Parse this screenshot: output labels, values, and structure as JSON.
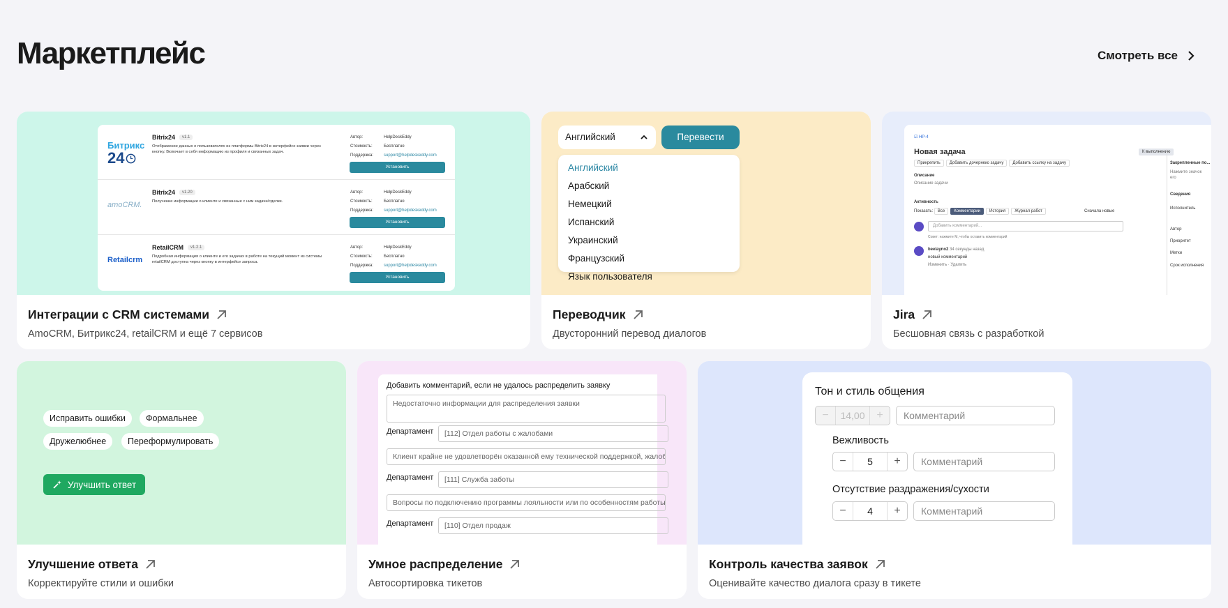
{
  "header": {
    "title": "Маркетплейс",
    "see_all": "Смотреть все"
  },
  "cards": {
    "crm": {
      "title": "Интеграции с CRM системами",
      "subtitle": "AmoCRM, Битрикс24, retailCRM и ещё 7 сервисов",
      "preview": {
        "meta_labels": {
          "author": "Автор:",
          "cost": "Стоимость:",
          "support": "Поддержка:"
        },
        "install": "Установить",
        "rows": [
          {
            "name": "Bitrix24",
            "version": "v1.1",
            "logo_top": "Битрикс",
            "logo_bottom": "24",
            "desc": "Отображение данных о пользователях из платформы Bitrix24 в интерфейсе заявки через кнопку. Включает в себя информацию из профиля и связанных задач.",
            "author": "HelpDeskEddy",
            "cost": "Бесплатно",
            "support": "support@helpdeskeddy.com"
          },
          {
            "name": "Bitrix24",
            "version": "v1.20",
            "logo_top": "amoCRM.",
            "logo_bottom": "",
            "desc": "Получение информации о клиенте и связанные с ним задачи/сделки.",
            "author": "HelpDeskEddy",
            "cost": "Бесплатно",
            "support": "support@helpdeskeddy.com"
          },
          {
            "name": "RetailCRM",
            "version": "v1.2.1",
            "logo_top": "Retailcrm",
            "logo_bottom": "",
            "desc": "Подробная информация о клиенте и его задачах в работе на текущий момент из системы retailCRM доступна через кнопку в интерфейсе запроса.",
            "author": "HelpDeskEddy",
            "cost": "Бесплатно",
            "support": "support@helpdeskeddy.com"
          }
        ]
      }
    },
    "translator": {
      "title": "Переводчик",
      "subtitle": "Двусторонний перевод диалогов",
      "preview": {
        "selected": "Английский",
        "button": "Перевести",
        "options": [
          "Английский",
          "Арабский",
          "Немецкий",
          "Испанский",
          "Украинский",
          "Французский",
          "Язык пользователя"
        ]
      }
    },
    "jira": {
      "title": "Jira",
      "subtitle": "Бесшовная связь с разработкой",
      "preview": {
        "key": "HP-4",
        "task_title": "Новая задача",
        "actions": [
          "Прикрепить",
          "Добавить дочернюю задачу",
          "Добавить ссылку на задачу"
        ],
        "desc_label": "Описание",
        "desc_value": "Описание задачи",
        "activity": "Активность",
        "show": "Показать:",
        "tabs": [
          "Все",
          "Комментарии",
          "История",
          "Журнал работ"
        ],
        "sort": "Сначала новые",
        "comment_placeholder": "Добавить комментарий...",
        "tip": "Совет: нажмите M, чтобы оставить комментарий",
        "commenter": "beelayno2",
        "comment_time": "34 секунды назад",
        "comment_text": "новый комментарий",
        "comment_actions": "Изменить · Удалить",
        "status": "К выполнению",
        "side_items": [
          "Закрепленные по...",
          "Нажмите значок",
          "его",
          "Сведения",
          "Исполнитель",
          "Автор",
          "Приоритет",
          "Метки",
          "Срок исполнения"
        ]
      }
    },
    "improve": {
      "title": "Улучшение ответа",
      "subtitle": "Корректируйте стили и ошибки",
      "preview": {
        "chips": [
          "Исправить ошибки",
          "Формальнее",
          "Дружелюбнее",
          "Переформулировать"
        ],
        "button": "Улучшить ответ"
      }
    },
    "distribution": {
      "title": "Умное распределение",
      "subtitle": "Автосортировка тикетов",
      "preview": {
        "heading": "Добавить комментарий, если не удалось распределить заявку",
        "placeholder": "Недостаточно информации для распределения заявки",
        "dept_label": "Департамент",
        "rows": [
          {
            "dept": "[112] Отдел работы с жалобами",
            "text": "Клиент крайне не удовлетворён оказанной ему технической поддержкой, жалобы на"
          },
          {
            "dept": "[111] Служба заботы",
            "text": "Вопросы по подключению программы лояльности или по особенностям работы прогр"
          },
          {
            "dept": "[110] Отдел продаж",
            "text": ""
          }
        ]
      }
    },
    "quality": {
      "title": "Контроль качества заявок",
      "subtitle": "Оценивайте качество диалога сразу в тикете",
      "preview": {
        "heading": "Тон и стиль общения",
        "main_value": "14,00",
        "comment": "Комментарий",
        "items": [
          {
            "label": "Вежливость",
            "value": "5"
          },
          {
            "label": "Отсутствие раздражения/сухости",
            "value": "4"
          }
        ]
      }
    }
  },
  "colors": {
    "teal": "#2a8a9e",
    "green": "#1fa860",
    "mint_bg": "#cdf6ea",
    "yellow_bg": "#fcebc6",
    "blue_bg": "#e7edfb",
    "green_bg": "#d2f5de",
    "pink_bg": "#f8e6f9",
    "lav_bg": "#dde6fc"
  },
  "icons": [
    "chevron-right-icon",
    "arrow-up-right-icon",
    "chevron-up-icon",
    "sparkle-wand-icon"
  ]
}
